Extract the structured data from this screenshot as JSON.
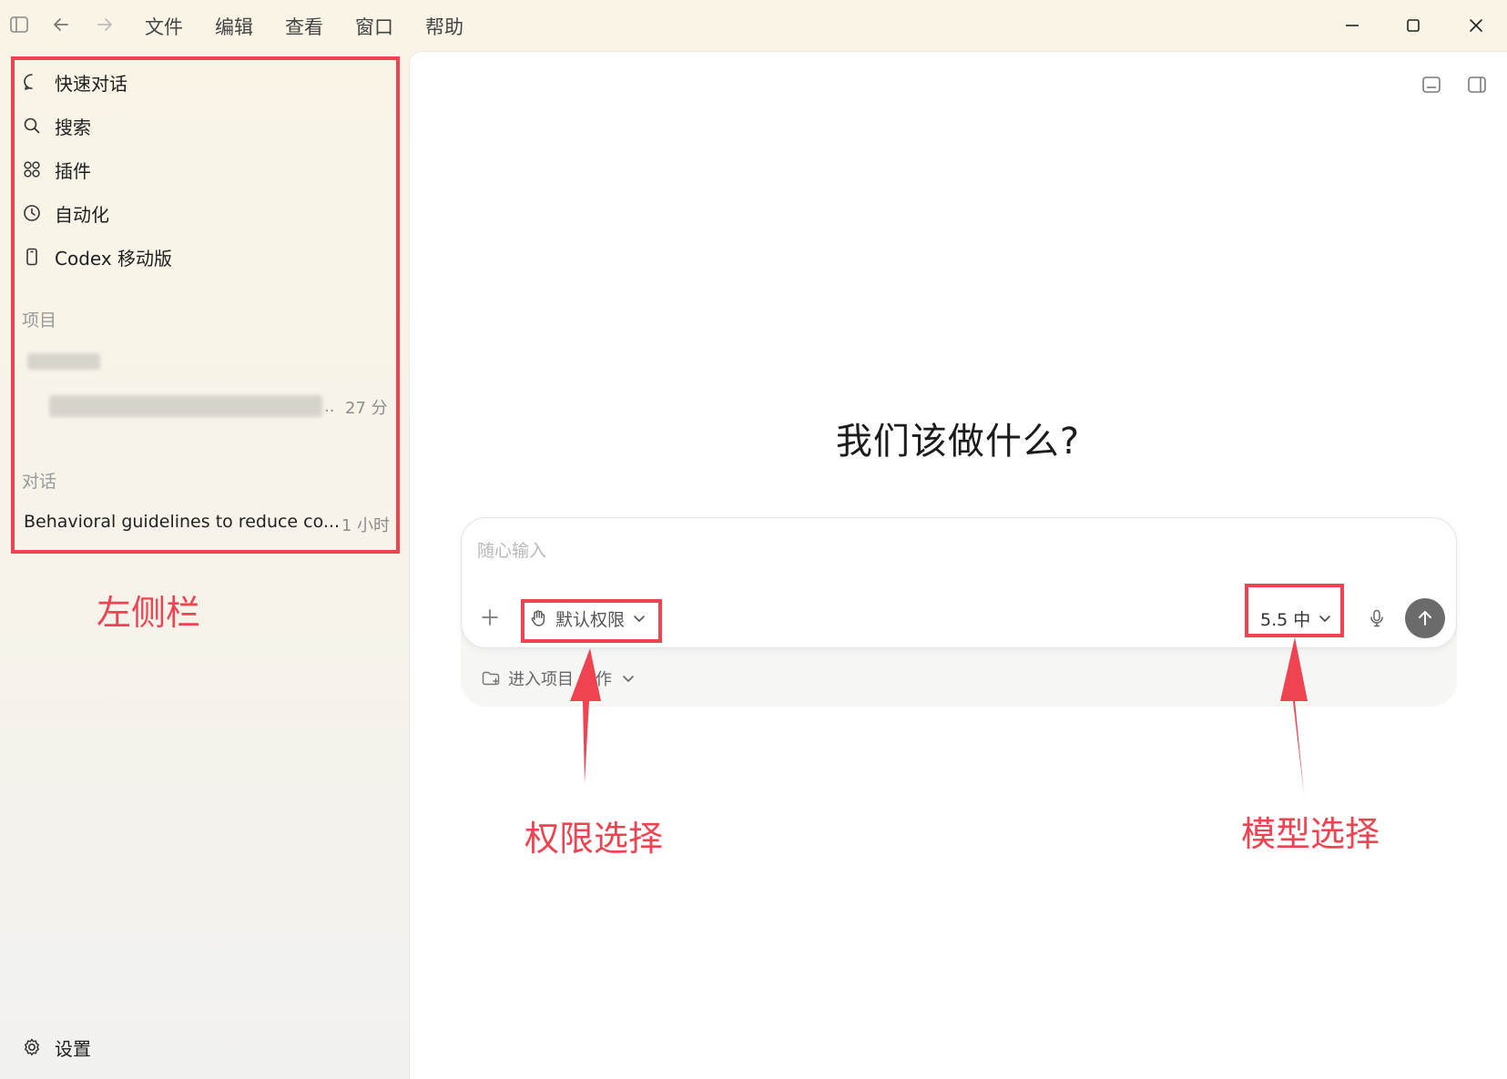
{
  "menubar": {
    "items": [
      "文件",
      "编辑",
      "查看",
      "窗口",
      "帮助"
    ]
  },
  "sidebar": {
    "nav": [
      {
        "label": "快速对话",
        "icon": "chat-bubble-icon"
      },
      {
        "label": "搜索",
        "icon": "search-icon"
      },
      {
        "label": "插件",
        "icon": "plugins-grid-icon"
      },
      {
        "label": "自动化",
        "icon": "clock-icon"
      },
      {
        "label": "Codex 移动版",
        "icon": "phone-icon"
      }
    ],
    "projects_label": "项目",
    "project_item_time": "27 分",
    "conversations_label": "对话",
    "conversation_item": {
      "title": "Behavioral guidelines to reduce co...",
      "time": "1 小时"
    },
    "settings_label": "设置"
  },
  "main": {
    "heading": "我们该做什么?",
    "composer": {
      "placeholder": "随心输入",
      "permission_label": "默认权限",
      "model_label": "5.5 中",
      "project_label": "进入项目",
      "project_label_tail": "作"
    }
  },
  "annotations": {
    "sidebar": "左侧栏",
    "permission": "权限选择",
    "model": "模型选择",
    "color": "#ef4352"
  }
}
